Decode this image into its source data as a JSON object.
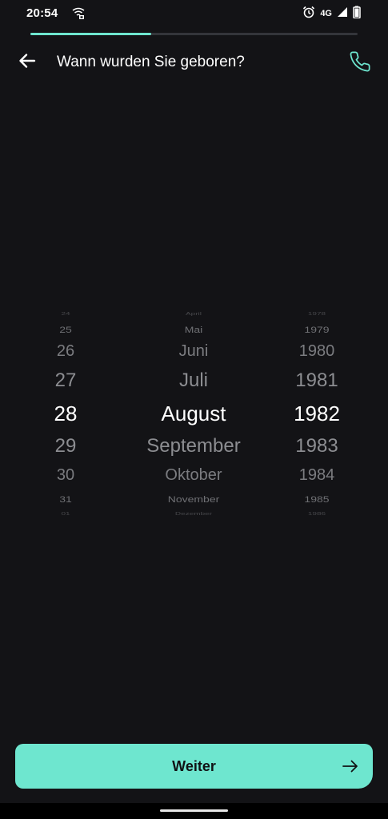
{
  "status_bar": {
    "time": "20:54",
    "network": "4G",
    "icons": [
      "wifi-notification-icon",
      "alarm-icon",
      "signal-icon",
      "battery-icon"
    ]
  },
  "progress": {
    "fraction": 0.37
  },
  "header": {
    "title": "Wann wurden Sie geboren?",
    "back_icon": "arrow-left-icon",
    "call_icon": "phone-icon"
  },
  "picker": {
    "day": {
      "visible": [
        "24",
        "25",
        "26",
        "27",
        "28",
        "29",
        "30",
        "31",
        "01"
      ],
      "selected": "28"
    },
    "month": {
      "visible": [
        "April",
        "Mai",
        "Juni",
        "Juli",
        "August",
        "September",
        "Oktober",
        "November",
        "Dezember"
      ],
      "selected": "August"
    },
    "year": {
      "visible": [
        "1978",
        "1979",
        "1980",
        "1981",
        "1982",
        "1983",
        "1984",
        "1985",
        "1986"
      ],
      "selected": "1982"
    }
  },
  "footer": {
    "continue_label": "Weiter",
    "continue_icon": "arrow-right-icon"
  },
  "colors": {
    "accent": "#6ee6cf",
    "background": "#131316",
    "button_text": "#111214"
  }
}
